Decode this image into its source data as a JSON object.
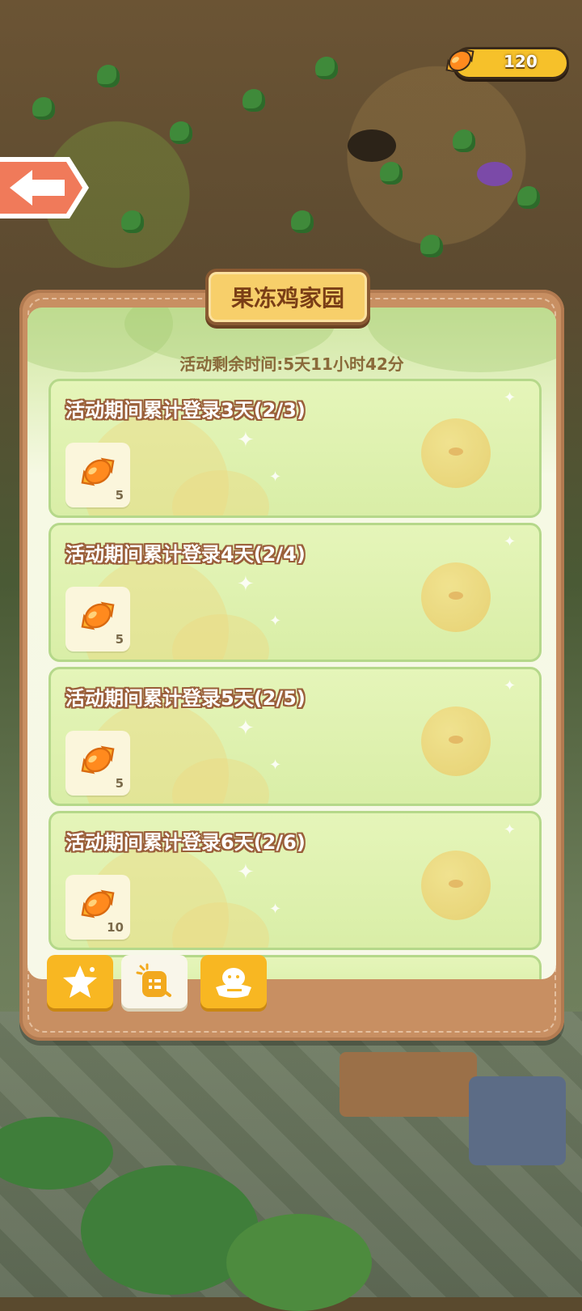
{
  "currency": {
    "icon": "candy-icon",
    "value": "120"
  },
  "back_button": {
    "icon": "arrow-left-icon"
  },
  "panel": {
    "title": "果冻鸡家园",
    "timer": "活动剩余时间:5天11小时42分"
  },
  "tasks": [
    {
      "title": "活动期间累计登录3天(2/3)",
      "reward_icon": "candy-icon",
      "reward_count": "5"
    },
    {
      "title": "活动期间累计登录4天(2/4)",
      "reward_icon": "candy-icon",
      "reward_count": "5"
    },
    {
      "title": "活动期间累计登录5天(2/5)",
      "reward_icon": "candy-icon",
      "reward_count": "5"
    },
    {
      "title": "活动期间累计登录6天(2/6)",
      "reward_icon": "candy-icon",
      "reward_count": "10"
    }
  ],
  "tabs": [
    {
      "icon": "star-icon",
      "selected": false
    },
    {
      "icon": "checklist-icon",
      "selected": true
    },
    {
      "icon": "chick-nest-icon",
      "selected": false
    }
  ],
  "colors": {
    "panel_frame": "#c88f62",
    "card_bg": "#dff1ae",
    "title_plate": "#f7cf6a",
    "tab_active": "#f8b722"
  }
}
